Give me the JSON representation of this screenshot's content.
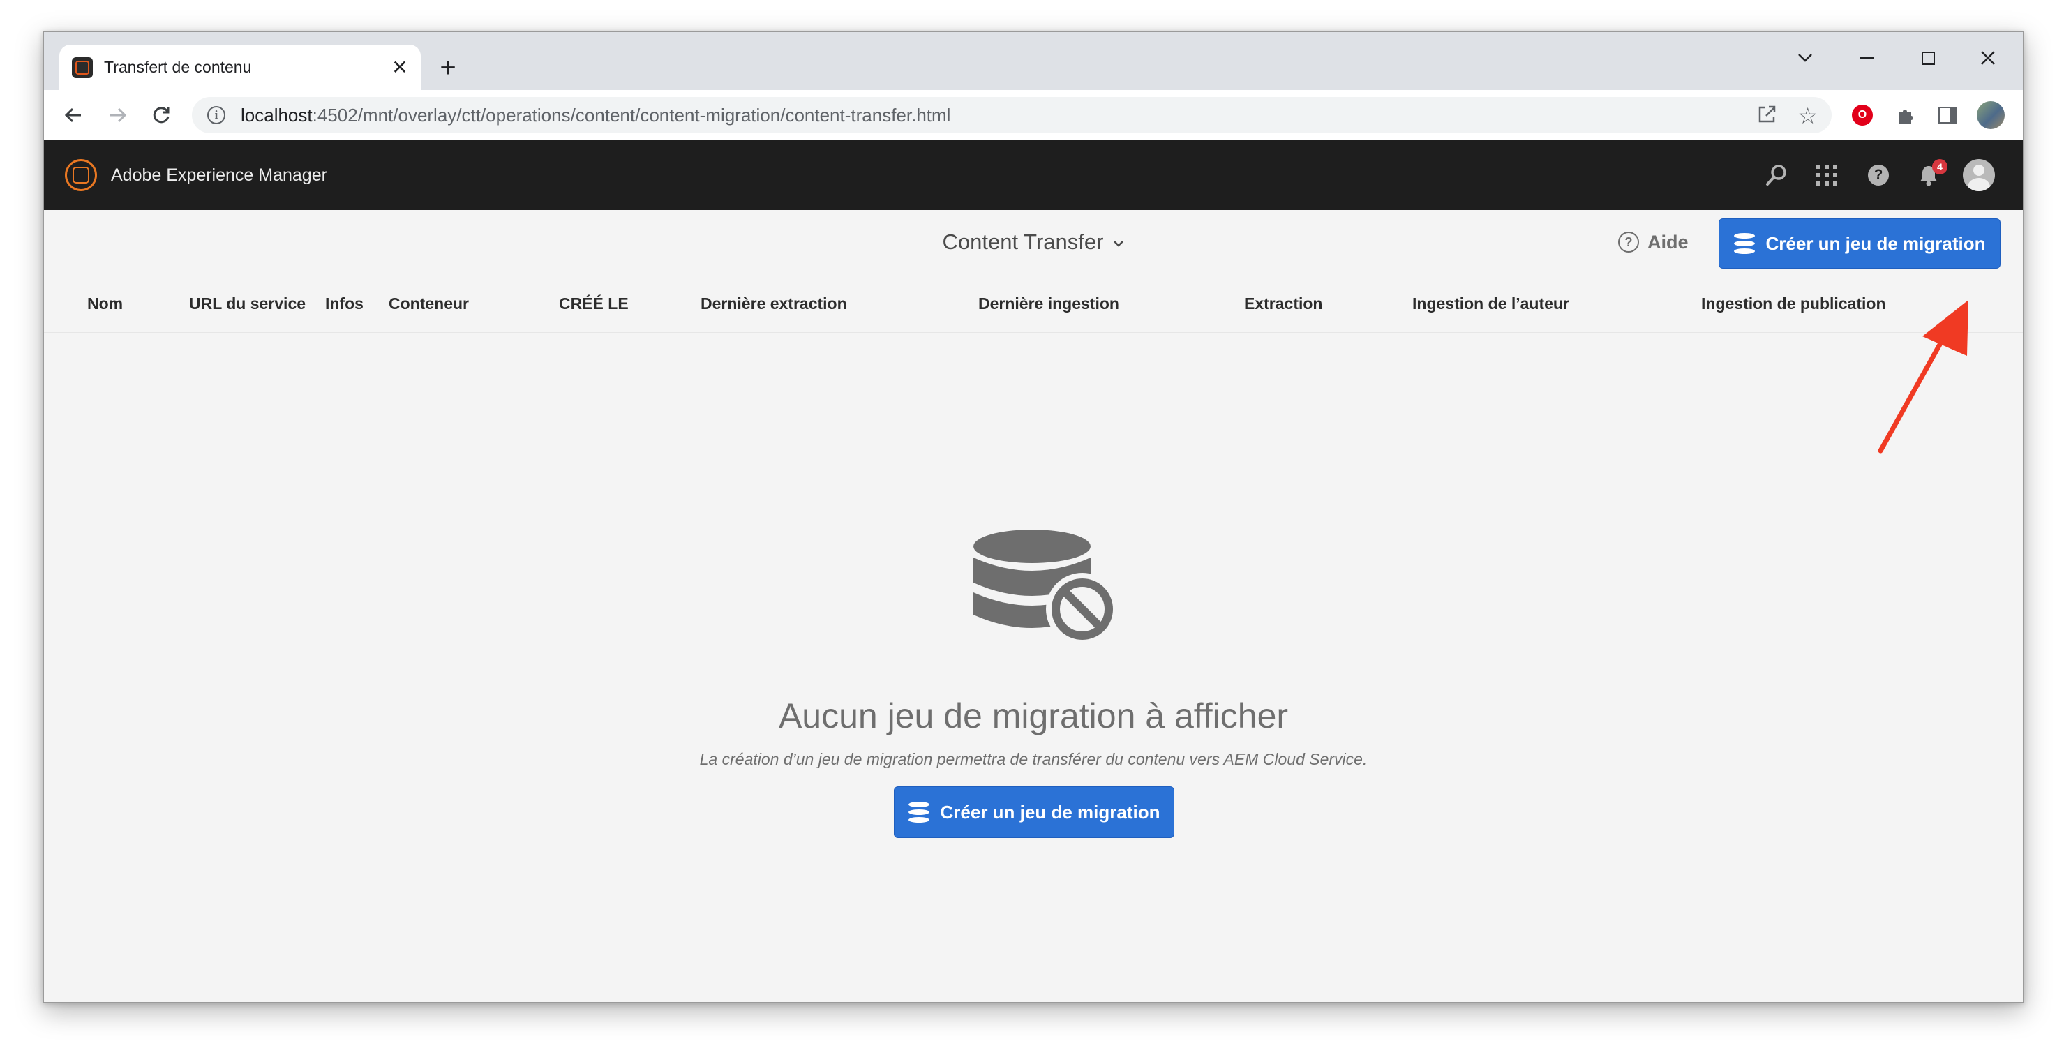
{
  "browser": {
    "tab_title": "Transfert de contenu",
    "tab_close": "✕",
    "new_tab": "+",
    "url_host": "localhost",
    "url_rest": ":4502/mnt/overlay/ctt/operations/content/content-migration/content-transfer.html",
    "info_glyph": "i",
    "extension_badge": "O",
    "icons": [
      "back-arrow-icon",
      "forward-arrow-icon",
      "reload-icon",
      "info-icon",
      "share-icon",
      "star-icon",
      "puzzle-icon",
      "side-panel-icon",
      "kebab-menu-icon"
    ]
  },
  "aem_header": {
    "product_name": "Adobe Experience Manager",
    "notification_count": "4",
    "help_glyph": "?"
  },
  "action_bar": {
    "console_title": "Content Transfer",
    "help_label": "Aide",
    "help_glyph": "?",
    "create_button_label": "Créer un jeu de migration"
  },
  "table": {
    "columns": [
      "Nom",
      "URL du service",
      "Infos",
      "Conteneur",
      "CRÉÉ LE",
      "Dernière extraction",
      "Dernière ingestion",
      "Extraction",
      "Ingestion de l’auteur",
      "Ingestion de publication"
    ]
  },
  "empty_state": {
    "heading": "Aucun jeu de migration à afficher",
    "subtext": "La création d’un jeu de migration permettra de transférer du contenu vers AEM Cloud Service.",
    "button_label": "Créer un jeu de migration"
  },
  "colors": {
    "accent_blue": "#2b72d6",
    "shell_dark": "#1e1e1e",
    "annotation_red": "#f03a23",
    "badge_red": "#d7373f"
  }
}
